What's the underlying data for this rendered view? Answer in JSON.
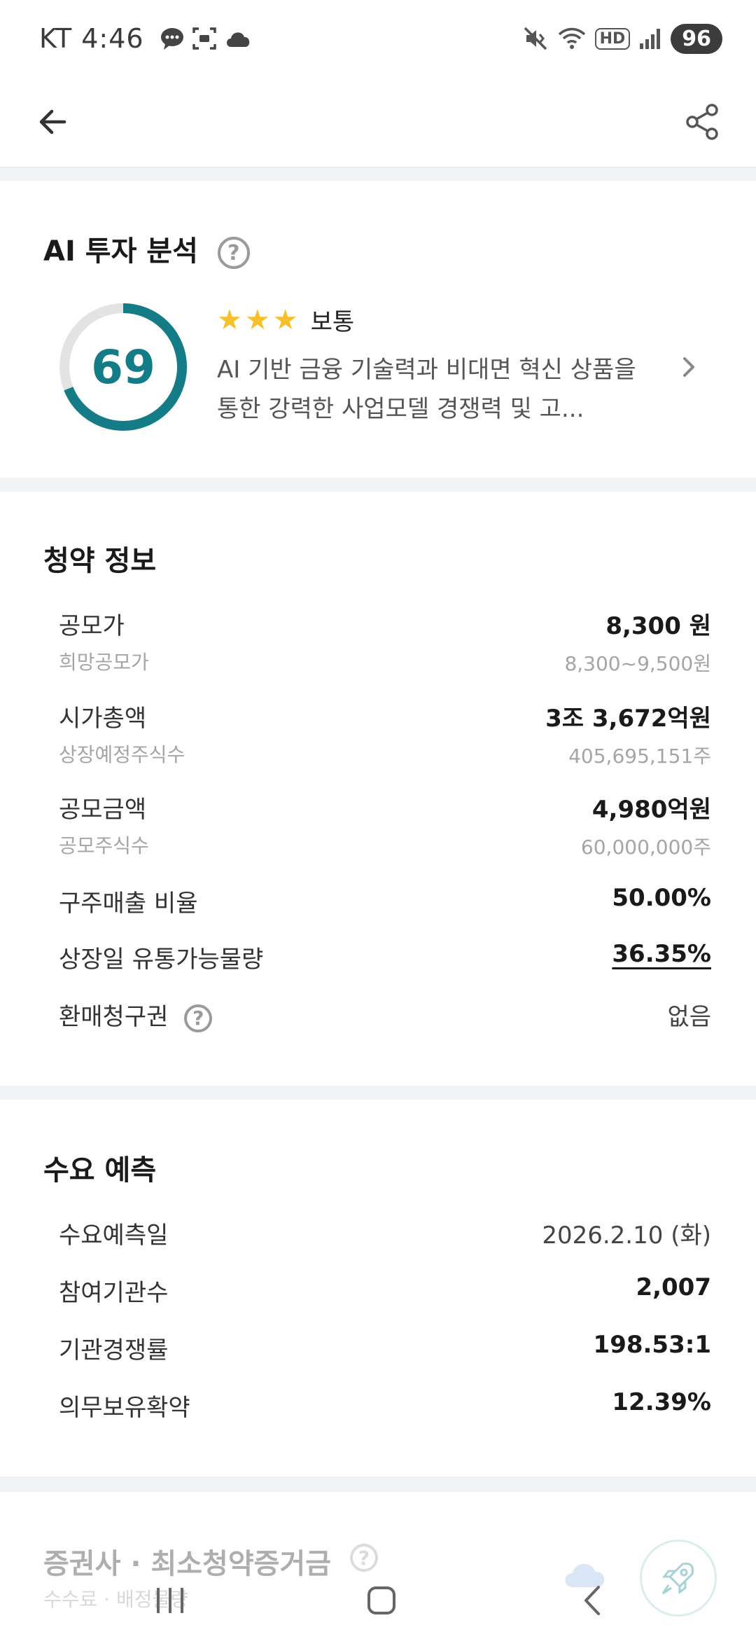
{
  "status_bar": {
    "carrier_time": "KT 4:46",
    "hd_label": "HD",
    "battery": "96",
    "left_icons": [
      "chat-bubble-icon",
      "screenshot-icon",
      "cloud-icon"
    ],
    "right_icons": [
      "mute-icon",
      "wifi-icon",
      "hd-icon",
      "signal-icon"
    ]
  },
  "app_bar": {
    "back_icon": "arrow-left-icon",
    "share_icon": "share-icon"
  },
  "ai_analysis": {
    "title": "AI 투자 분석",
    "score": "69",
    "score_fraction": 0.69,
    "accent_color": "#137c86",
    "track_color": "#e3e3e3",
    "stars": 3,
    "rating_label": "보통",
    "summary": "AI 기반 금융 기술력과 비대면 혁신 상품을 통한 강력한 사업모델 경쟁력 및 고..."
  },
  "subscription_info": {
    "title": "청약 정보",
    "rows": [
      {
        "label": "공모가",
        "value": "8,300 원",
        "sub_label": "희망공모가",
        "sub_value": "8,300~9,500원"
      },
      {
        "label": "시가총액",
        "value": "3조 3,672억원",
        "sub_label": "상장예정주식수",
        "sub_value": "405,695,151주"
      },
      {
        "label": "공모금액",
        "value": "4,980억원",
        "sub_label": "공모주식수",
        "sub_value": "60,000,000주"
      },
      {
        "label": "구주매출 비율",
        "value": "50.00%"
      },
      {
        "label": "상장일 유통가능물량",
        "value": "36.35%"
      },
      {
        "label": "환매청구권",
        "value": "없음"
      }
    ]
  },
  "demand_forecast": {
    "title": "수요 예측",
    "rows": [
      {
        "label": "수요예측일",
        "value": "2026.2.10 (화)"
      },
      {
        "label": "참여기관수",
        "value": "2,007"
      },
      {
        "label": "기관경쟁률",
        "value": "198.53:1"
      },
      {
        "label": "의무보유확약",
        "value": "12.39%"
      }
    ]
  },
  "broker_section": {
    "title": "증권사 · 최소청약증거금",
    "subtitle": "수수료 · 배정물량"
  },
  "nav_bar": {
    "icons": [
      "recent-apps-icon",
      "home-icon",
      "back-nav-icon"
    ]
  }
}
